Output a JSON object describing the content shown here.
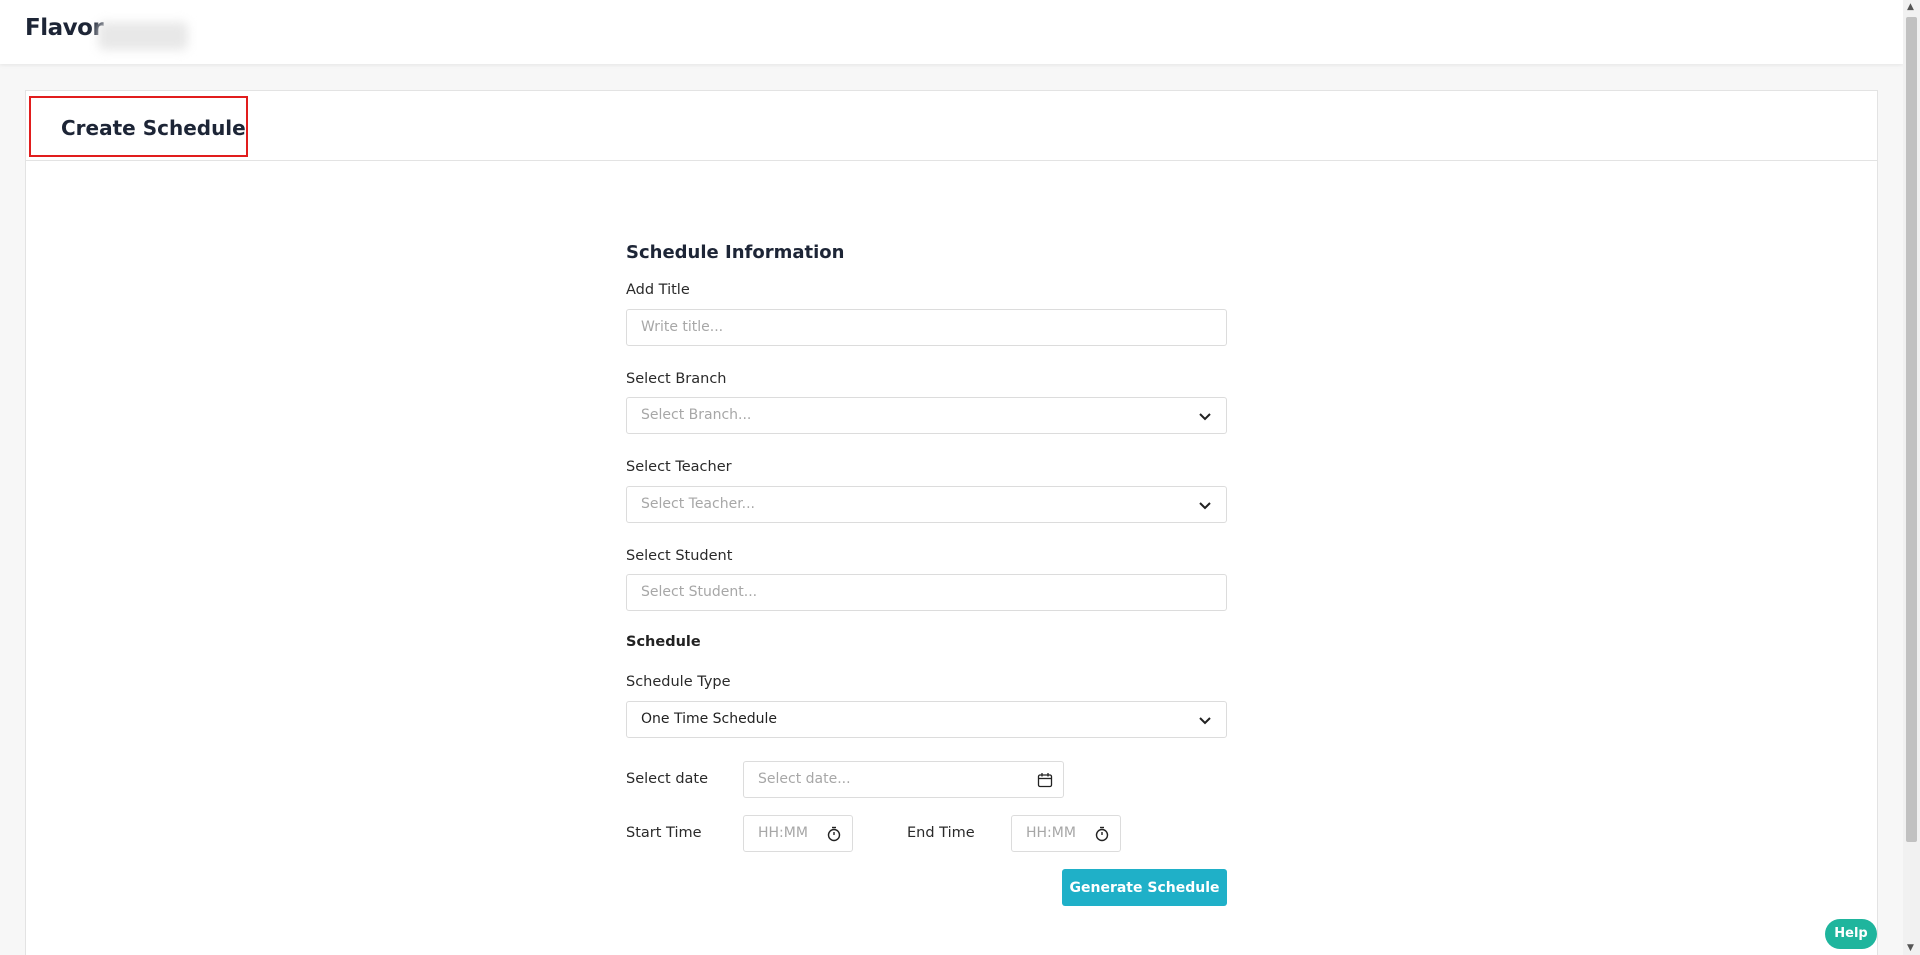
{
  "header": {
    "brand": "Flavor"
  },
  "page": {
    "title": "Create Schedule"
  },
  "form": {
    "section_title": "Schedule Information",
    "title_label": "Add Title",
    "title_placeholder": "Write title...",
    "branch_label": "Select Branch",
    "branch_placeholder": "Select Branch...",
    "teacher_label": "Select Teacher",
    "teacher_placeholder": "Select Teacher...",
    "student_label": "Select Student",
    "student_placeholder": "Select Student...",
    "schedule_heading": "Schedule",
    "schedule_type_label": "Schedule Type",
    "schedule_type_value": "One Time Schedule",
    "date_label": "Select date",
    "date_placeholder": "Select date...",
    "start_label": "Start Time",
    "start_placeholder": "HH:MM",
    "end_label": "End Time",
    "end_placeholder": "HH:MM",
    "generate_button": "Generate Schedule"
  },
  "help": {
    "label": "Help"
  },
  "icons": {
    "dropdown": "chevron-down-icon",
    "calendar": "calendar-icon",
    "time": "stopwatch-icon"
  },
  "colors": {
    "primary": "#1fb0c8",
    "help": "#1fb59d",
    "highlight": "#e11d1d",
    "brand_text": "#1d2536"
  }
}
